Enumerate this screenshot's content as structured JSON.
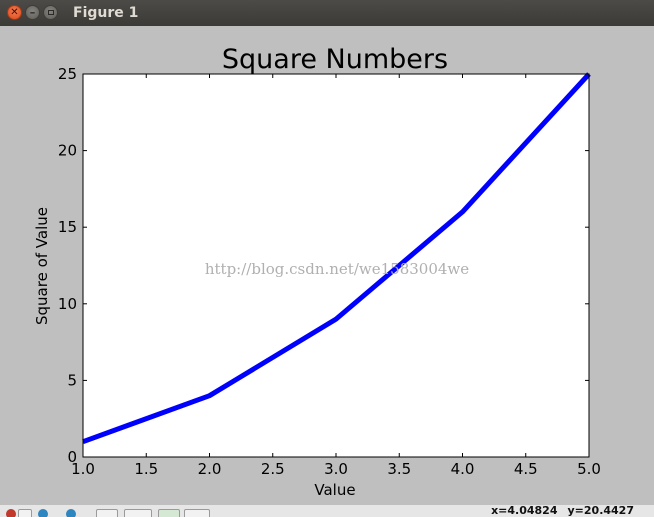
{
  "window": {
    "title": "Figure 1",
    "controls": [
      "close-icon",
      "minimize-icon",
      "maximize-icon"
    ]
  },
  "colors": {
    "line": "#0000ff",
    "figure_bg": "#bfbfbf",
    "axes_bg": "#ffffff",
    "watermark": "#b0b0b0"
  },
  "watermark": "http://blog.csdn.net/we1583004we",
  "status": {
    "x_readout": "x=4.04824",
    "y_readout": "y=20.4427"
  },
  "toolbar": {
    "icons": [
      "home-icon",
      "back-icon",
      "forward-icon",
      "pan-icon",
      "zoom-icon",
      "subplots-icon",
      "save-icon"
    ]
  },
  "chart_data": {
    "type": "line",
    "title": "Square Numbers",
    "xlabel": "Value",
    "ylabel": "Square of Value",
    "x": [
      1,
      2,
      3,
      4,
      5
    ],
    "series": [
      {
        "values": [
          1,
          4,
          9,
          16,
          25
        ],
        "color": "#0000ff"
      }
    ],
    "xlim": [
      1.0,
      5.0
    ],
    "ylim": [
      0,
      25
    ],
    "xticks": [
      1.0,
      1.5,
      2.0,
      2.5,
      3.0,
      3.5,
      4.0,
      4.5,
      5.0
    ],
    "xtick_labels": [
      "1.0",
      "1.5",
      "2.0",
      "2.5",
      "3.0",
      "3.5",
      "4.0",
      "4.5",
      "5.0"
    ],
    "yticks": [
      0,
      5,
      10,
      15,
      20,
      25
    ],
    "ytick_labels": [
      "0",
      "5",
      "10",
      "15",
      "20",
      "25"
    ],
    "grid": false,
    "legend": "none"
  }
}
